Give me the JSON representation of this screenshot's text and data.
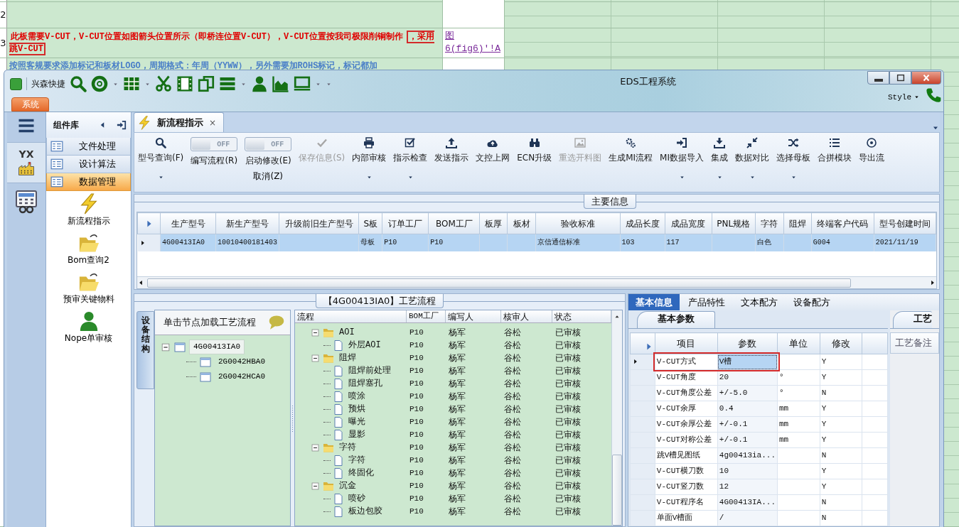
{
  "spreadsheet": {
    "row_numbers": [
      "2",
      "3"
    ],
    "note_parts": [
      {
        "text": "此板需要V-CUT，V-CUT位置如图箭头位置所示（即桥连位置V-CUT），V-CUT位置按我司极限削铜制作",
        "boxed": false
      },
      {
        "text": "，采用跳V-CUT",
        "boxed": true
      }
    ],
    "link": "图6(fig6)'!A",
    "next_note": "按照客规要求添加标记和板材LOGO，周期格式：年周（YYWW），另外需要加ROHS标记，标记都加"
  },
  "window": {
    "title": "EDS工程系统",
    "quick_access_label": "兴森快捷",
    "app_tab": "系统",
    "style_menu": "Style"
  },
  "rail": {
    "logo_text": "YX"
  },
  "component_panel": {
    "title": "组件库",
    "categories": [
      {
        "label": "文件处理",
        "selected": false
      },
      {
        "label": "设计算法",
        "selected": false
      },
      {
        "label": "数据管理",
        "selected": true
      }
    ],
    "items": [
      {
        "label": "新流程指示"
      },
      {
        "label": "Bom查询2"
      },
      {
        "label": "预审关键物料"
      },
      {
        "label": "Nope单审核"
      }
    ]
  },
  "doc_tabs": [
    {
      "label": "新流程指示",
      "close": "×",
      "selected": true
    }
  ],
  "ribbon": [
    {
      "kind": "button",
      "label": "型号查询(F)",
      "disabled": false,
      "dropdown": true
    },
    {
      "kind": "toggle",
      "label": "编写流程(R)",
      "switch_text": "OFF",
      "on": false
    },
    {
      "kind": "toggle",
      "label": "启动修改(E)",
      "switch_text": "OFF",
      "on": false,
      "extra": "取消(Z)"
    },
    {
      "kind": "button",
      "label": "保存信息(S)",
      "disabled": true,
      "dropdown": false
    },
    {
      "kind": "button",
      "label": "内部审核",
      "disabled": false,
      "dropdown": true
    },
    {
      "kind": "button",
      "label": "指示检查",
      "disabled": false,
      "dropdown": true
    },
    {
      "kind": "button",
      "label": "发送指示",
      "disabled": false,
      "dropdown": false
    },
    {
      "kind": "button",
      "label": "文控上网",
      "disabled": false,
      "dropdown": false
    },
    {
      "kind": "button",
      "label": "ECN升级",
      "disabled": false,
      "dropdown": false
    },
    {
      "kind": "button",
      "label": "重选开料图",
      "disabled": true,
      "dropdown": false
    },
    {
      "kind": "button",
      "label": "生成MI流程",
      "disabled": false,
      "dropdown": false
    },
    {
      "kind": "button",
      "label": "MI数据导入",
      "disabled": false,
      "dropdown": true
    },
    {
      "kind": "button",
      "label": "集成",
      "disabled": false,
      "dropdown": true
    },
    {
      "kind": "button",
      "label": "数据对比",
      "disabled": false,
      "dropdown": true
    },
    {
      "kind": "button",
      "label": "选择母板",
      "disabled": false,
      "dropdown": true
    },
    {
      "kind": "button",
      "label": "合拼模块",
      "disabled": false,
      "dropdown": false
    },
    {
      "kind": "button",
      "label": "导出流",
      "disabled": false,
      "dropdown": false
    }
  ],
  "main_info": {
    "title": "主要信息",
    "columns": [
      "生产型号",
      "新生产型号",
      "升级前旧生产型号",
      "S板",
      "订单工厂",
      "BOM工厂",
      "板厚",
      "板材",
      "验收标准",
      "成品长度",
      "成品宽度",
      "PNL规格",
      "字符",
      "阻焊",
      "终端客户代码",
      "型号创建时间"
    ],
    "rows": [
      {
        "selected": true,
        "cells": [
          "4G00413IA0",
          "10010400181403",
          null,
          "母板",
          "P10",
          "P10",
          null,
          null,
          "京信通信标准",
          "103",
          "117",
          null,
          "白色",
          null,
          "G004",
          "2021/11/19"
        ]
      }
    ]
  },
  "process_panel": {
    "title": "【4G00413IA0】工艺流程",
    "side_tab": "设备结构",
    "tree_hint": "单击节点加载工艺流程",
    "tree": [
      {
        "label": "4G00413IA0",
        "selected": true,
        "expanded": true,
        "children": [
          {
            "label": "2G0042HBA0",
            "selected": false
          },
          {
            "label": "2G0042HCA0",
            "selected": false
          }
        ]
      }
    ],
    "grid": {
      "columns": [
        "流程",
        "BOM工厂",
        "编写人",
        "核审人",
        "状态"
      ],
      "rows": [
        {
          "expanded": true,
          "cells": [
            "AOI",
            "P10",
            "杨军",
            "谷松",
            "已审核"
          ],
          "children": [
            {
              "cells": [
                "外层AOI",
                "P10",
                "杨军",
                "谷松",
                "已审核"
              ]
            }
          ]
        },
        {
          "expanded": true,
          "cells": [
            "阻焊",
            "P10",
            "杨军",
            "谷松",
            "已审核"
          ],
          "children": [
            {
              "cells": [
                "阻焊前处理",
                "P10",
                "杨军",
                "谷松",
                "已审核"
              ]
            },
            {
              "cells": [
                "阻焊塞孔",
                "P10",
                "杨军",
                "谷松",
                "已审核"
              ]
            },
            {
              "cells": [
                "喷涂",
                "P10",
                "杨军",
                "谷松",
                "已审核"
              ]
            },
            {
              "cells": [
                "预烘",
                "P10",
                "杨军",
                "谷松",
                "已审核"
              ]
            },
            {
              "cells": [
                "曝光",
                "P10",
                "杨军",
                "谷松",
                "已审核"
              ]
            },
            {
              "cells": [
                "显影",
                "P10",
                "杨军",
                "谷松",
                "已审核"
              ]
            }
          ]
        },
        {
          "expanded": true,
          "cells": [
            "字符",
            "P10",
            "杨军",
            "谷松",
            "已审核"
          ],
          "children": [
            {
              "cells": [
                "字符",
                "P10",
                "杨军",
                "谷松",
                "已审核"
              ]
            },
            {
              "cells": [
                "终固化",
                "P10",
                "杨军",
                "谷松",
                "已审核"
              ]
            }
          ]
        },
        {
          "expanded": true,
          "cells": [
            "沉金",
            "P10",
            "杨军",
            "谷松",
            "已审核"
          ],
          "children": [
            {
              "cells": [
                "喷砂",
                "P10",
                "杨军",
                "谷松",
                "已审核"
              ]
            },
            {
              "cells": [
                "板边包胶",
                "P10",
                "杨军",
                "谷松",
                "已审核"
              ]
            }
          ]
        }
      ]
    }
  },
  "detail_panel": {
    "tabs": [
      {
        "label": "基本信息",
        "selected": true
      },
      {
        "label": "产品特性",
        "selected": false
      },
      {
        "label": "文本配方",
        "selected": false
      },
      {
        "label": "设备配方",
        "selected": false
      }
    ],
    "sub_tab": "基本参数",
    "columns": [
      "项目",
      "参数",
      "单位",
      "修改"
    ],
    "rows": [
      {
        "cells": [
          "V-CUT方式",
          "V槽",
          null,
          "Y"
        ],
        "selected": true,
        "annotated": true
      },
      {
        "cells": [
          "V-CUT角度",
          "20",
          "°",
          "Y"
        ],
        "selected": false,
        "annotated": false
      },
      {
        "cells": [
          "V-CUT角度公差",
          "+/-5.0",
          "°",
          "N"
        ],
        "selected": false,
        "annotated": false
      },
      {
        "cells": [
          "V-CUT余厚",
          "0.4",
          "mm",
          "Y"
        ],
        "selected": false,
        "annotated": false
      },
      {
        "cells": [
          "V-CUT余厚公差",
          "+/-0.1",
          "mm",
          "Y"
        ],
        "selected": false,
        "annotated": false
      },
      {
        "cells": [
          "V-CUT对称公差",
          "+/-0.1",
          "mm",
          "Y"
        ],
        "selected": false,
        "annotated": false
      },
      {
        "cells": [
          "跳V槽见图纸",
          "4g00413ia...",
          null,
          "N"
        ],
        "selected": false,
        "annotated": false
      },
      {
        "cells": [
          "V-CUT横刀数",
          "10",
          null,
          "Y"
        ],
        "selected": false,
        "annotated": false
      },
      {
        "cells": [
          "V-CUT竖刀数",
          "12",
          null,
          "Y"
        ],
        "selected": false,
        "annotated": false
      },
      {
        "cells": [
          "V-CUT程序名",
          "4G00413IA...",
          null,
          "N"
        ],
        "selected": false,
        "annotated": false
      },
      {
        "cells": [
          "单面V槽面",
          "/",
          null,
          "N"
        ],
        "selected": false,
        "annotated": false
      }
    ],
    "side_tab": "工艺",
    "side_column": "工艺备注"
  }
}
